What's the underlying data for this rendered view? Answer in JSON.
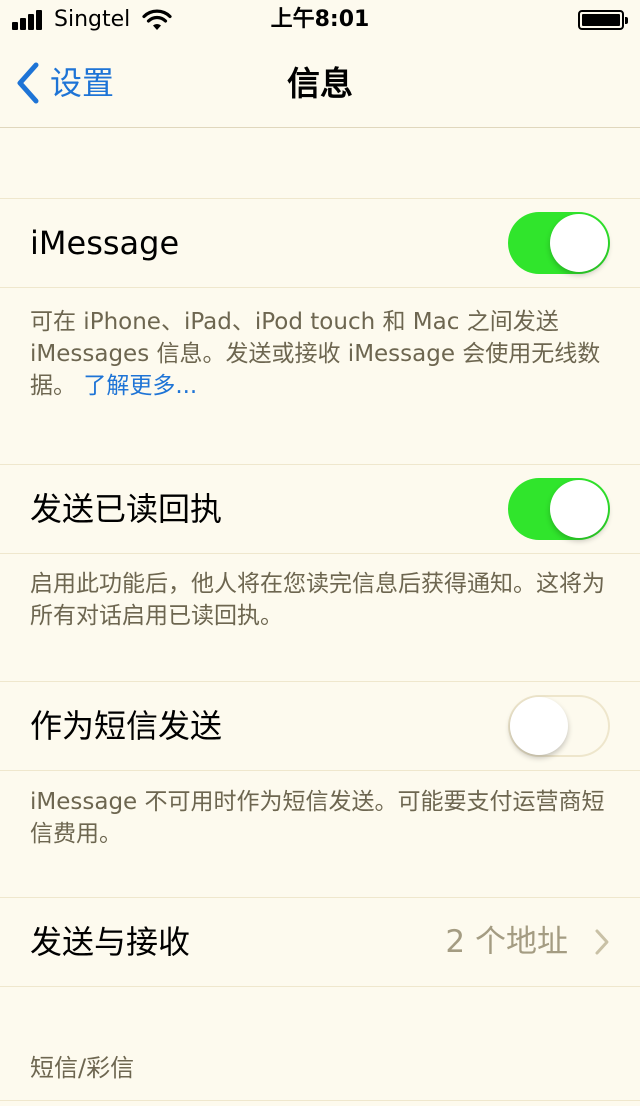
{
  "status_bar": {
    "carrier": "Singtel",
    "time": "上午8:01",
    "icons": [
      "signal-icon",
      "wifi-icon",
      "battery-icon"
    ]
  },
  "nav": {
    "back_label": "设置",
    "title": "信息"
  },
  "settings": {
    "imessage": {
      "label": "iMessage",
      "enabled": true,
      "description": "可在 iPhone、iPad、iPod touch 和 Mac 之间发送 iMessages 信息。发送或接收 iMessage 会使用无线数据。",
      "link": "了解更多..."
    },
    "read_receipts": {
      "label": "发送已读回执",
      "enabled": true,
      "description": "启用此功能后，他人将在您读完信息后获得通知。这将为所有对话启用已读回执。"
    },
    "send_as_sms": {
      "label": "作为短信发送",
      "enabled": false,
      "description": "iMessage 不可用时作为短信发送。可能要支付运营商短信费用。"
    },
    "send_receive": {
      "label": "发送与接收",
      "value": "2 个地址"
    }
  },
  "section_header": "短信/彩信",
  "colors": {
    "background": "#fdfaee",
    "accent": "#1e74d6",
    "toggle_on": "#30e52c",
    "secondary_text": "#6d6650"
  }
}
